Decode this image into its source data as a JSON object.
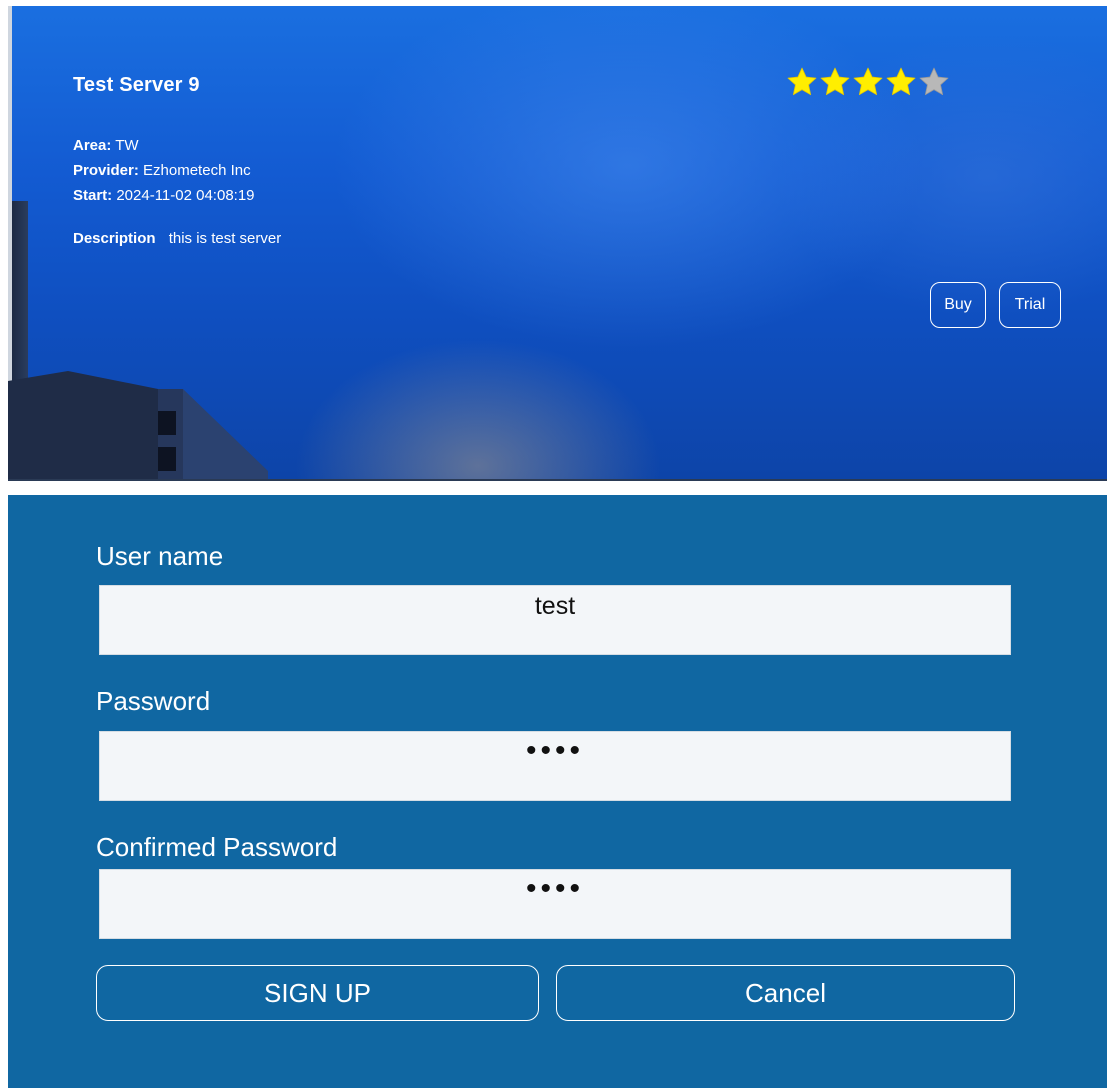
{
  "server": {
    "title": "Test Server 9",
    "rating": 4,
    "rating_max": 5,
    "star_filled_color": "#ffee00",
    "star_empty_color": "#b8b8b8",
    "area_label": "Area:",
    "area_value": "TW",
    "provider_label": "Provider:",
    "provider_value": "Ezhometech Inc",
    "start_label": "Start:",
    "start_value": "2024-11-02 04:08:19",
    "description_label": "Description",
    "description_value": "this is test server",
    "buy_label": "Buy",
    "trial_label": "Trial"
  },
  "signup": {
    "background_color": "#1067a2",
    "username_label": "User name",
    "username_value": "test",
    "password_label": "Password",
    "password_value": "••••",
    "confirm_label": "Confirmed Password",
    "confirm_value": "••••",
    "signup_label": "SIGN UP",
    "cancel_label": "Cancel"
  }
}
